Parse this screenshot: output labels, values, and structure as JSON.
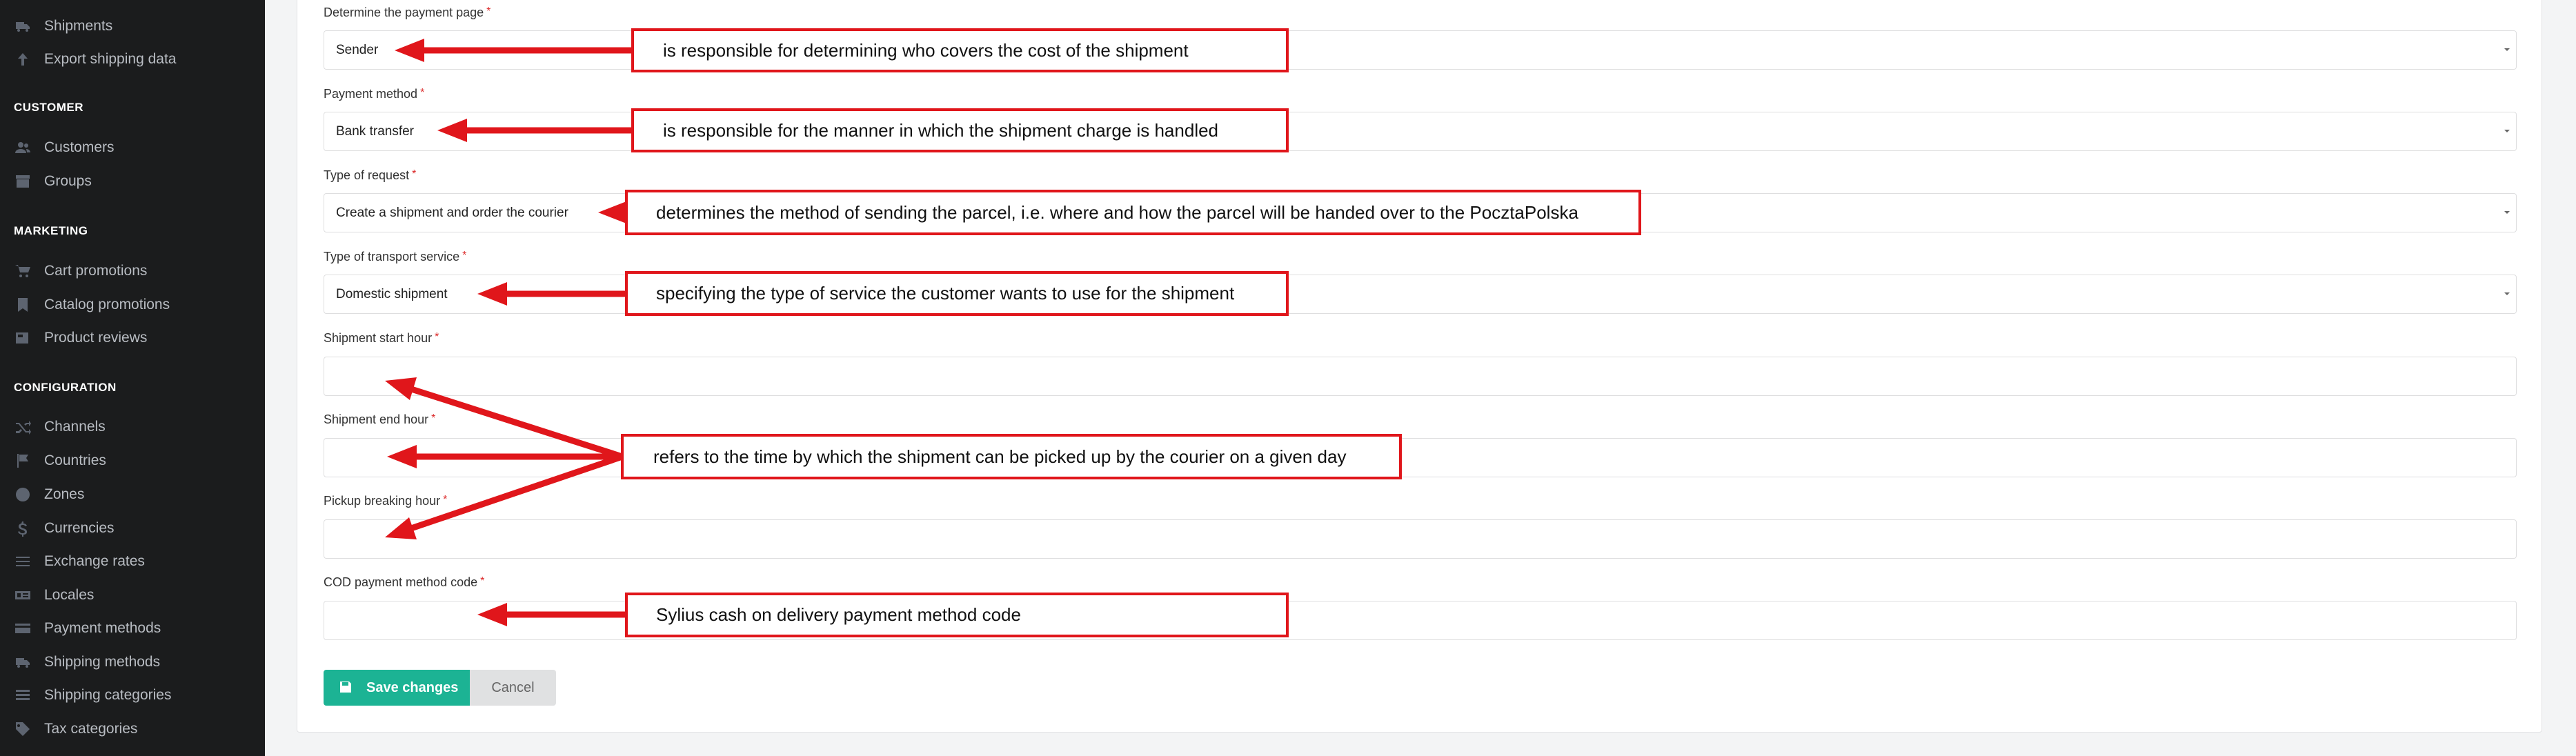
{
  "sidebar": {
    "top_items": [
      {
        "label": "Shipments",
        "icon": "truck-icon"
      },
      {
        "label": "Export shipping data",
        "icon": "arrow-up-icon"
      }
    ],
    "sections": [
      {
        "title": "CUSTOMER",
        "items": [
          {
            "label": "Customers",
            "icon": "users-icon"
          },
          {
            "label": "Groups",
            "icon": "archive-icon"
          }
        ]
      },
      {
        "title": "MARKETING",
        "items": [
          {
            "label": "Cart promotions",
            "icon": "cart-icon"
          },
          {
            "label": "Catalog promotions",
            "icon": "bookmark-icon"
          },
          {
            "label": "Product reviews",
            "icon": "newspaper-icon"
          }
        ]
      },
      {
        "title": "CONFIGURATION",
        "items": [
          {
            "label": "Channels",
            "icon": "random-icon"
          },
          {
            "label": "Countries",
            "icon": "flag-icon"
          },
          {
            "label": "Zones",
            "icon": "globe-icon"
          },
          {
            "label": "Currencies",
            "icon": "dollar-icon"
          },
          {
            "label": "Exchange rates",
            "icon": "sliders-icon"
          },
          {
            "label": "Locales",
            "icon": "translate-icon"
          },
          {
            "label": "Payment methods",
            "icon": "payment-icon"
          },
          {
            "label": "Shipping methods",
            "icon": "shipping-icon"
          },
          {
            "label": "Shipping categories",
            "icon": "list-icon"
          },
          {
            "label": "Tax categories",
            "icon": "tags-icon"
          }
        ]
      }
    ]
  },
  "form": {
    "payment_page": {
      "label": "Determine the payment page",
      "value": "Sender"
    },
    "payment_method": {
      "label": "Payment method",
      "value": "Bank transfer"
    },
    "request_type": {
      "label": "Type of request",
      "value": "Create a shipment and order the courier"
    },
    "transport_service": {
      "label": "Type of transport service",
      "value": "Domestic shipment"
    },
    "start_hour": {
      "label": "Shipment start hour",
      "value": ""
    },
    "end_hour": {
      "label": "Shipment end hour",
      "value": ""
    },
    "breaking_hour": {
      "label": "Pickup breaking hour",
      "value": ""
    },
    "cod_code": {
      "label": "COD payment method code",
      "value": ""
    },
    "required_mark": "*"
  },
  "buttons": {
    "save": "Save changes",
    "cancel": "Cancel"
  },
  "annotations": {
    "payment_page": "is responsible for determining who covers the cost of the shipment",
    "payment_method": "is responsible for the manner in which the shipment charge is handled",
    "request_type": "determines the method of sending the parcel, i.e. where and how the parcel will be handed over to the PocztaPolska",
    "transport_service": "specifying the type of service the customer wants to use for the shipment",
    "hours": "refers to the time by which the shipment can be picked up by the courier on a given day",
    "cod_code": "Sylius cash on delivery payment method code"
  },
  "colors": {
    "sidebar_bg": "#1b1c1d",
    "accent": "#1cb394",
    "annotation": "#e0161b",
    "required": "#db2828"
  }
}
